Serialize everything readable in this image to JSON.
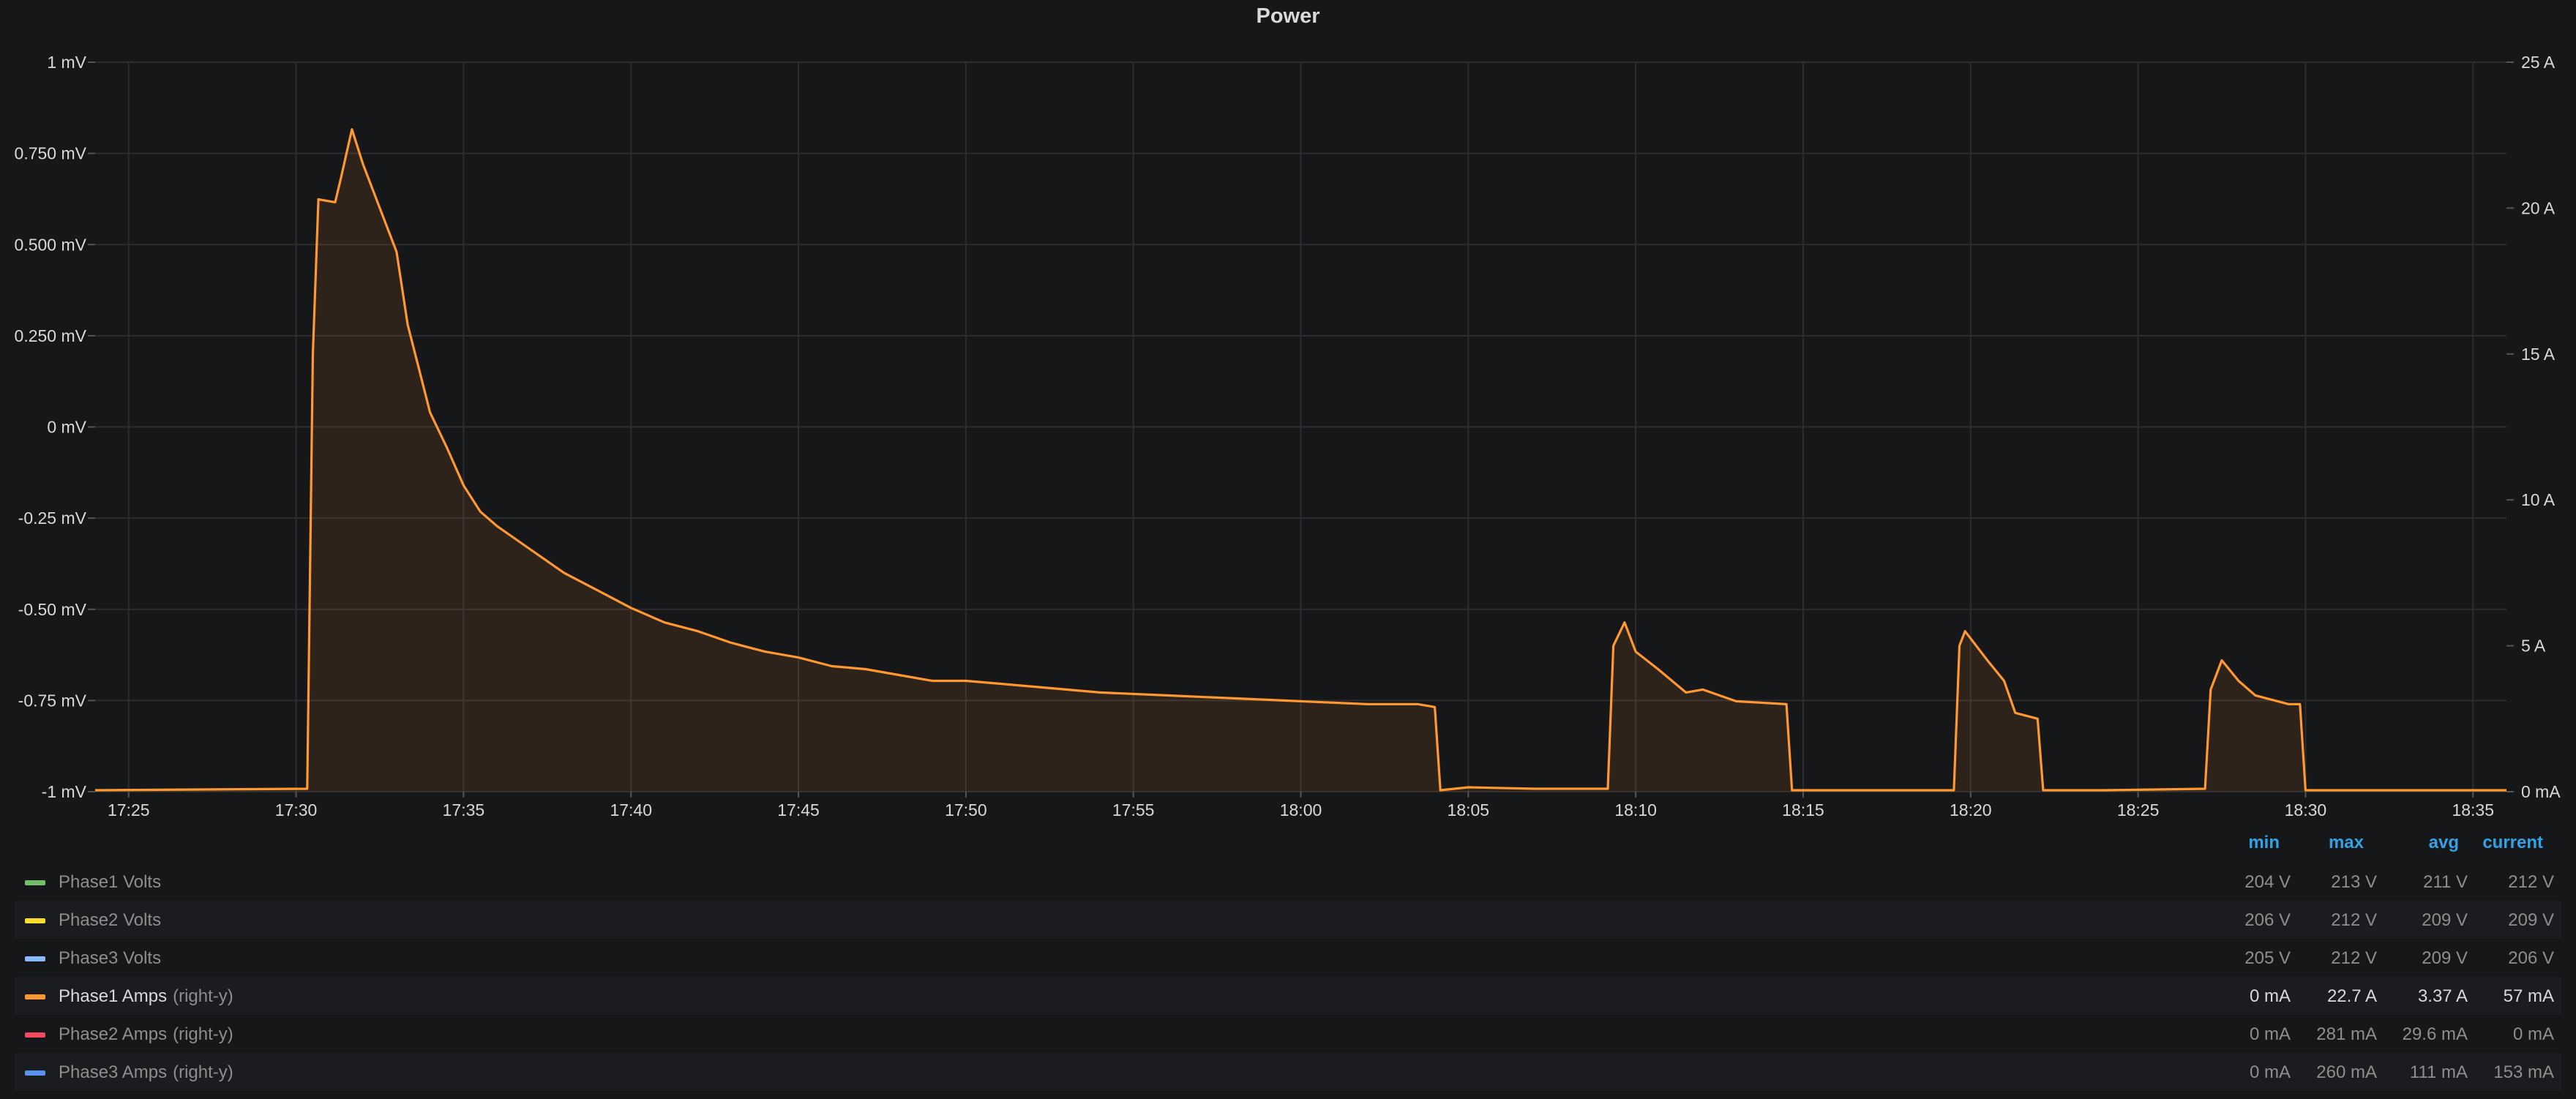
{
  "panel": {
    "title": "Power"
  },
  "chart_data": {
    "type": "area",
    "title": "Power",
    "x_ticks": [
      "17:25",
      "17:30",
      "17:35",
      "17:40",
      "17:45",
      "17:50",
      "17:55",
      "18:00",
      "18:05",
      "18:10",
      "18:15",
      "18:20",
      "18:25",
      "18:30",
      "18:35"
    ],
    "xlim": [
      "17:24",
      "18:36"
    ],
    "y_left": {
      "ylim": [
        -1,
        1
      ],
      "unit": "mV",
      "tick_values": [
        -1,
        -0.75,
        -0.5,
        -0.25,
        0,
        0.25,
        0.5,
        0.75,
        1
      ],
      "tick_labels": [
        "-1 mV",
        "-0.75 mV",
        "-0.50 mV",
        "-0.25 mV",
        "0 mV",
        "0.250 mV",
        "0.500 mV",
        "0.750 mV",
        "1 mV"
      ]
    },
    "y_right": {
      "ylim": [
        0,
        25
      ],
      "unit": "A",
      "tick_values": [
        0,
        5,
        10,
        15,
        20,
        25
      ],
      "tick_labels": [
        "0 mA",
        "5 A",
        "10 A",
        "15 A",
        "20 A",
        "25 A"
      ]
    },
    "grid": true,
    "legend_placement": "bottom",
    "series": [
      {
        "name": "Phase1 Amps",
        "axis": "right",
        "color": "#ff9830",
        "points": [
          [
            "17:24",
            0.05
          ],
          [
            "17:30:20",
            0.1
          ],
          [
            "17:30:30",
            15.0
          ],
          [
            "17:30:40",
            20.3
          ],
          [
            "17:31:10",
            20.2
          ],
          [
            "17:31:20",
            21.0
          ],
          [
            "17:31:40",
            22.7
          ],
          [
            "17:32:00",
            21.5
          ],
          [
            "17:32:30",
            20.0
          ],
          [
            "17:33:00",
            18.5
          ],
          [
            "17:33:20",
            16.0
          ],
          [
            "17:33:40",
            14.5
          ],
          [
            "17:34:00",
            13.0
          ],
          [
            "17:34:30",
            11.8
          ],
          [
            "17:35:00",
            10.5
          ],
          [
            "17:35:30",
            9.6
          ],
          [
            "17:36:00",
            9.1
          ],
          [
            "17:36:30",
            8.7
          ],
          [
            "17:37:00",
            8.3
          ],
          [
            "17:38:00",
            7.5
          ],
          [
            "17:39:00",
            6.9
          ],
          [
            "17:40:00",
            6.3
          ],
          [
            "17:41:00",
            5.8
          ],
          [
            "17:42:00",
            5.5
          ],
          [
            "17:43:00",
            5.1
          ],
          [
            "17:44:00",
            4.8
          ],
          [
            "17:45:00",
            4.6
          ],
          [
            "17:46:00",
            4.3
          ],
          [
            "17:47:00",
            4.2
          ],
          [
            "17:48:00",
            4.0
          ],
          [
            "17:49:00",
            3.8
          ],
          [
            "17:50:00",
            3.8
          ],
          [
            "17:51:00",
            3.7
          ],
          [
            "17:52:00",
            3.6
          ],
          [
            "17:53:00",
            3.5
          ],
          [
            "17:54:00",
            3.4
          ],
          [
            "17:56:00",
            3.3
          ],
          [
            "17:58:00",
            3.2
          ],
          [
            "18:00:00",
            3.1
          ],
          [
            "18:02:00",
            3.0
          ],
          [
            "18:03:30",
            3.0
          ],
          [
            "18:04:00",
            2.9
          ],
          [
            "18:04:10",
            0.05
          ],
          [
            "18:05:00",
            0.15
          ],
          [
            "18:07:00",
            0.1
          ],
          [
            "18:09:10",
            0.1
          ],
          [
            "18:09:20",
            5.0
          ],
          [
            "18:09:40",
            5.8
          ],
          [
            "18:10:00",
            4.8
          ],
          [
            "18:10:40",
            4.2
          ],
          [
            "18:11:30",
            3.4
          ],
          [
            "18:12:00",
            3.5
          ],
          [
            "18:13:00",
            3.1
          ],
          [
            "18:14:30",
            3.0
          ],
          [
            "18:14:40",
            0.05
          ],
          [
            "18:16:00",
            0.05
          ],
          [
            "18:19:30",
            0.05
          ],
          [
            "18:19:40",
            5.0
          ],
          [
            "18:19:50",
            5.5
          ],
          [
            "18:20:30",
            4.5
          ],
          [
            "18:21:00",
            3.8
          ],
          [
            "18:21:20",
            2.7
          ],
          [
            "18:22:00",
            2.5
          ],
          [
            "18:22:10",
            0.05
          ],
          [
            "18:24:00",
            0.05
          ],
          [
            "18:27:00",
            0.1
          ],
          [
            "18:27:10",
            3.5
          ],
          [
            "18:27:30",
            4.5
          ],
          [
            "18:28:00",
            3.8
          ],
          [
            "18:28:30",
            3.3
          ],
          [
            "18:29:30",
            3.0
          ],
          [
            "18:29:50",
            3.0
          ],
          [
            "18:30:00",
            0.05
          ],
          [
            "18:32:00",
            0.05
          ],
          [
            "18:35:30",
            0.05
          ],
          [
            "18:36",
            0.05
          ]
        ]
      }
    ]
  },
  "legend": {
    "headers": [
      "min",
      "max",
      "avg",
      "current"
    ],
    "rows": [
      {
        "name": "Phase1 Volts",
        "axis_tag": "",
        "color": "#73bf69",
        "min": "204 V",
        "max": "213 V",
        "avg": "211 V",
        "current": "212 V"
      },
      {
        "name": "Phase2 Volts",
        "axis_tag": "",
        "color": "#fade2a",
        "min": "206 V",
        "max": "212 V",
        "avg": "209 V",
        "current": "209 V"
      },
      {
        "name": "Phase3 Volts",
        "axis_tag": "",
        "color": "#8ab8ff",
        "min": "205 V",
        "max": "212 V",
        "avg": "209 V",
        "current": "206 V"
      },
      {
        "name": "Phase1 Amps",
        "axis_tag": "(right-y)",
        "color": "#ff9830",
        "min": "0 mA",
        "max": "22.7 A",
        "avg": "3.37 A",
        "current": "57 mA"
      },
      {
        "name": "Phase2 Amps",
        "axis_tag": "(right-y)",
        "color": "#f2495c",
        "min": "0 mA",
        "max": "281 mA",
        "avg": "29.6 mA",
        "current": "0 mA"
      },
      {
        "name": "Phase3 Amps",
        "axis_tag": "(right-y)",
        "color": "#5794f2",
        "min": "0 mA",
        "max": "260 mA",
        "avg": "111 mA",
        "current": "153 mA"
      }
    ]
  }
}
